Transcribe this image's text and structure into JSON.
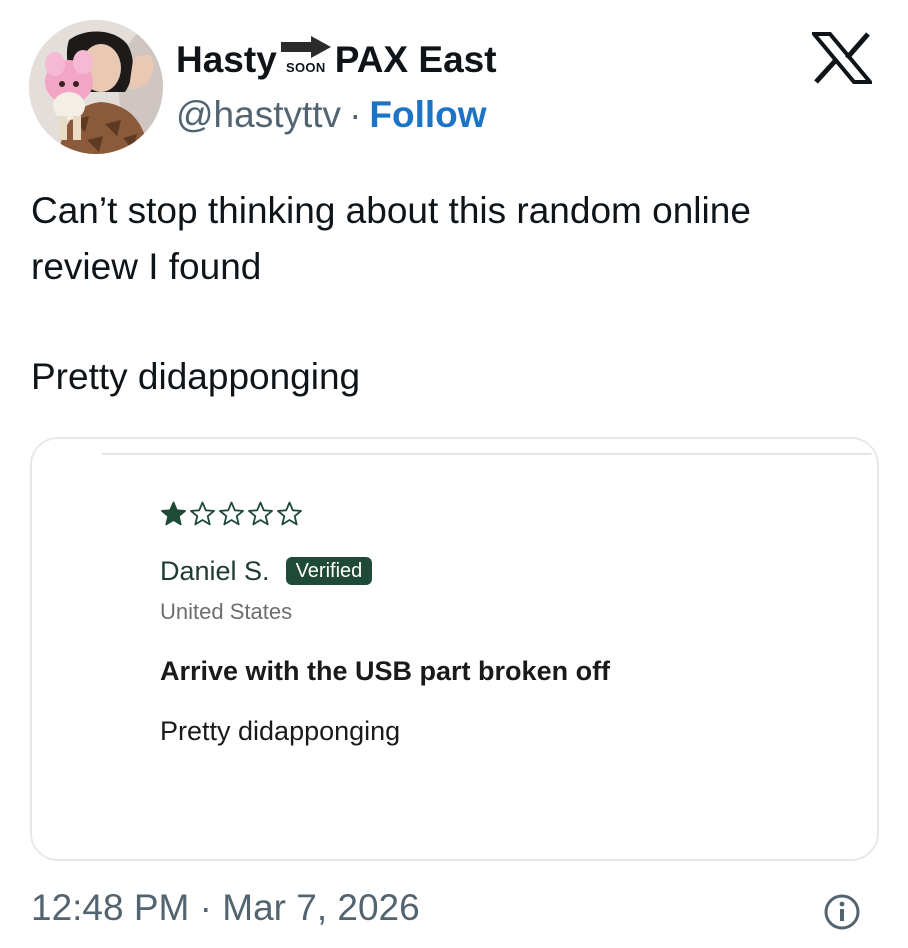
{
  "author": {
    "name_before_arrow": "Hasty",
    "arrow_caption": "SOON",
    "name_after_arrow": "PAX East",
    "handle": "@hastyttv",
    "separator": "·",
    "follow_label": "Follow",
    "avatar_icon": "profile-photo"
  },
  "brand": {
    "logo_icon": "x-logo-icon"
  },
  "tweet": {
    "text_line1": "Can’t stop thinking about this random online",
    "text_line2": "review I found",
    "text_line3": "Pretty didapponging"
  },
  "review_card": {
    "rating": 1,
    "rating_max": 5,
    "star_color": "#1f4a37",
    "reviewer_name": "Daniel S.",
    "verified_label": "Verified",
    "country": "United States",
    "title": "Arrive with the USB part broken off",
    "body": "Pretty didapponging"
  },
  "footer": {
    "timestamp": "12:48 PM · Mar 7, 2026",
    "info_icon": "info-circle-icon"
  },
  "colors": {
    "text_primary": "#0f1419",
    "text_secondary": "#536471",
    "follow_link": "#1d74c6",
    "badge_bg": "#1f4a37"
  }
}
